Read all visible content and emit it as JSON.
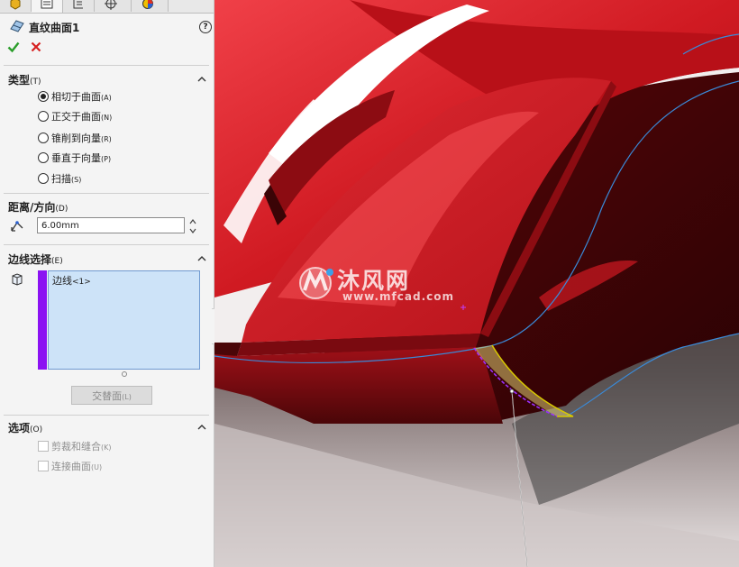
{
  "feature": {
    "title": "直纹曲面1",
    "help_label": "?"
  },
  "sections": {
    "type": {
      "title": "类型",
      "hotkey": "(T)",
      "options": [
        {
          "label": "相切于曲面",
          "hotkey": "(A)",
          "selected": true
        },
        {
          "label": "正交于曲面",
          "hotkey": "(N)",
          "selected": false
        },
        {
          "label": "锥削到向量",
          "hotkey": "(R)",
          "selected": false
        },
        {
          "label": "垂直于向量",
          "hotkey": "(P)",
          "selected": false
        },
        {
          "label": "扫描",
          "hotkey": "(S)",
          "selected": false
        }
      ]
    },
    "distance": {
      "title": "距离/方向",
      "hotkey": "(D)",
      "value": "6.00mm"
    },
    "edges": {
      "title": "边线选择",
      "hotkey": "(E)",
      "items": [
        {
          "label": "边线",
          "suffix": "<1>"
        }
      ],
      "alt_face_label": "交替面",
      "alt_face_hotkey": "(L)"
    },
    "options": {
      "title": "选项",
      "hotkey": "(O)",
      "checks": [
        {
          "label": "剪裁和缝合",
          "hotkey": "(K)",
          "checked": false
        },
        {
          "label": "连接曲面",
          "hotkey": "(U)",
          "checked": false
        }
      ]
    }
  },
  "watermark": {
    "title": "沐风网",
    "url": "www.mfcad.com"
  },
  "colors": {
    "selection_bar": "#8b12f2",
    "list_bg": "#cde3f8",
    "ok": "#2a9d2a",
    "cancel": "#d61f1f",
    "model_red": "#c9141c"
  }
}
